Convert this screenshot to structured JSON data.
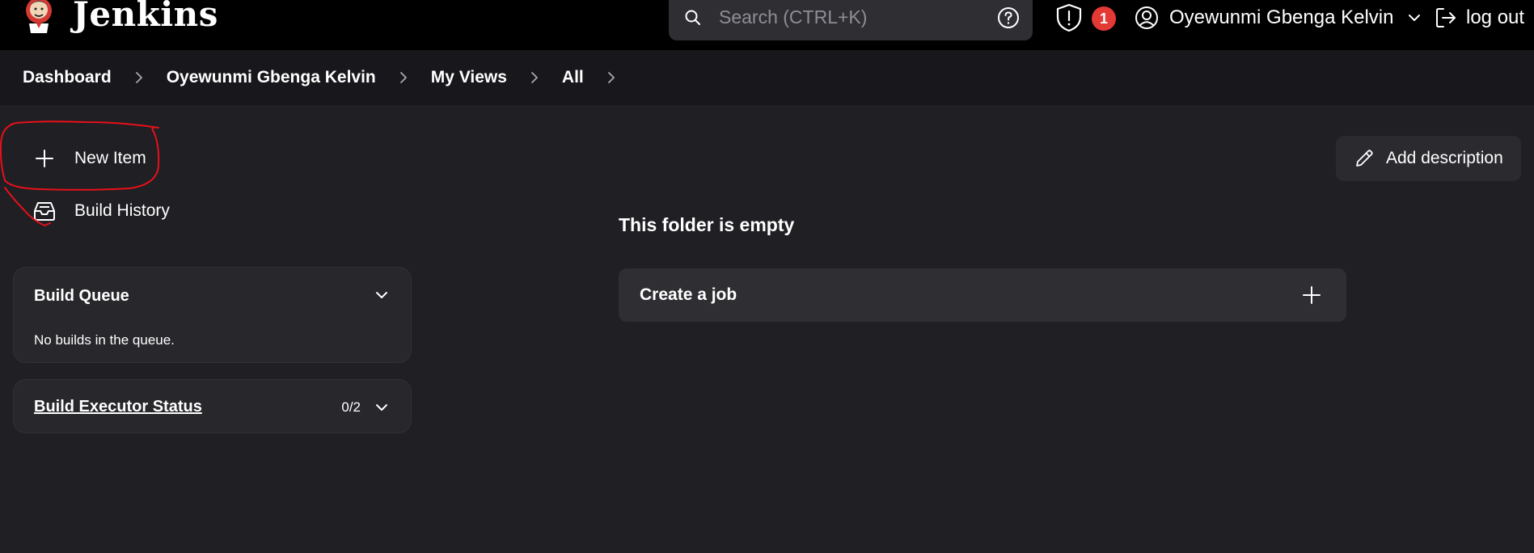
{
  "header": {
    "brand": "Jenkins",
    "search_placeholder": "Search (CTRL+K)",
    "security_badge": "1",
    "user_name": "Oyewunmi Gbenga Kelvin",
    "logout_label": "log out"
  },
  "breadcrumb": [
    "Dashboard",
    "Oyewunmi Gbenga Kelvin",
    "My Views",
    "All"
  ],
  "tasks": {
    "new_item": "New Item",
    "build_history": "Build History"
  },
  "build_queue": {
    "title": "Build Queue",
    "empty_text": "No builds in the queue."
  },
  "build_executor": {
    "title": "Build Executor Status",
    "count": "0/2"
  },
  "main": {
    "add_description": "Add description",
    "empty_title": "This folder is empty",
    "create_job": "Create a job"
  },
  "colors": {
    "background": "#1f1f24",
    "header": "#000000",
    "breadcrumb_bar": "#18181c",
    "card": "#2e2e33",
    "badge": "#e53935",
    "annotation": "#e8101a"
  }
}
